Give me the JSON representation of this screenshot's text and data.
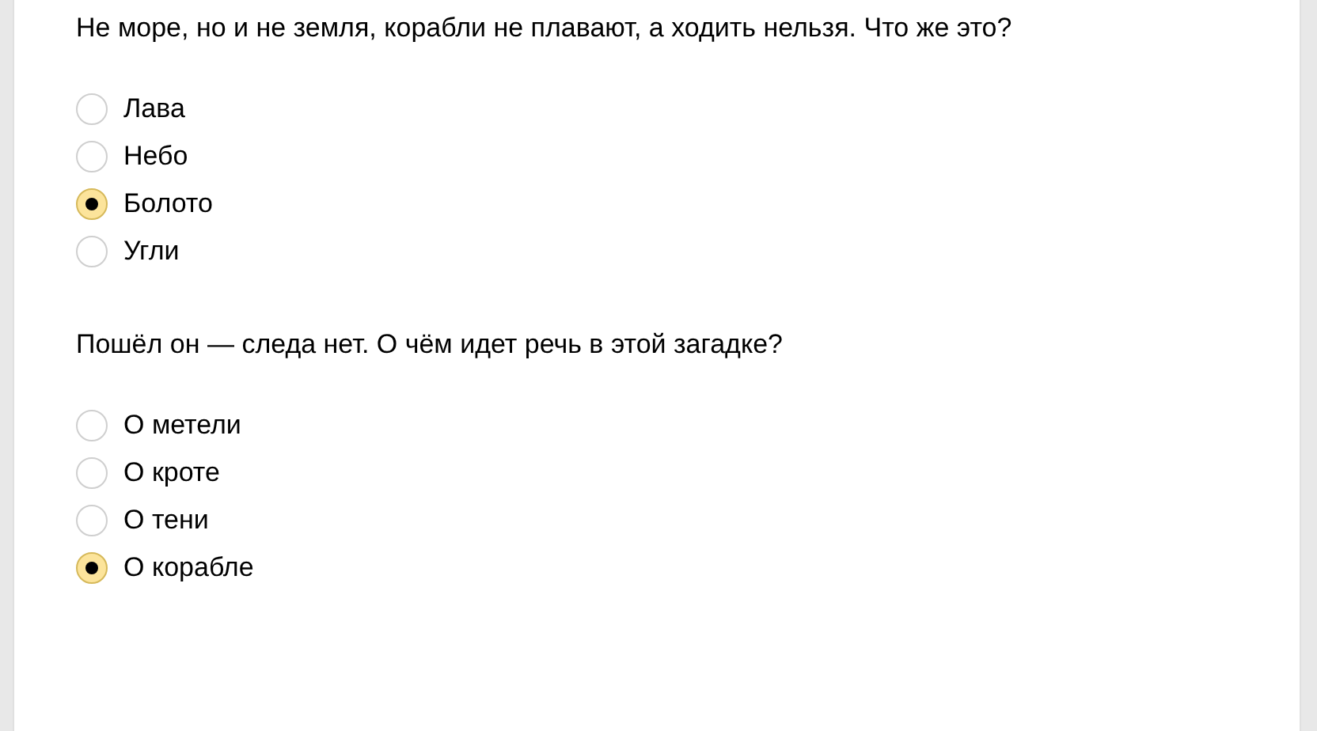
{
  "questions": [
    {
      "text": "Не море, но и не земля, корабли не плавают, а ходить нельзя. Что же это?",
      "options": [
        {
          "label": "Лава",
          "selected": false
        },
        {
          "label": "Небо",
          "selected": false
        },
        {
          "label": "Болото",
          "selected": true
        },
        {
          "label": "Угли",
          "selected": false
        }
      ]
    },
    {
      "text": "Пошёл он — следа нет. О чём идет речь в этой загадке?",
      "options": [
        {
          "label": "О метели",
          "selected": false
        },
        {
          "label": "О кроте",
          "selected": false
        },
        {
          "label": "О тени",
          "selected": false
        },
        {
          "label": "О корабле",
          "selected": true
        }
      ]
    }
  ]
}
